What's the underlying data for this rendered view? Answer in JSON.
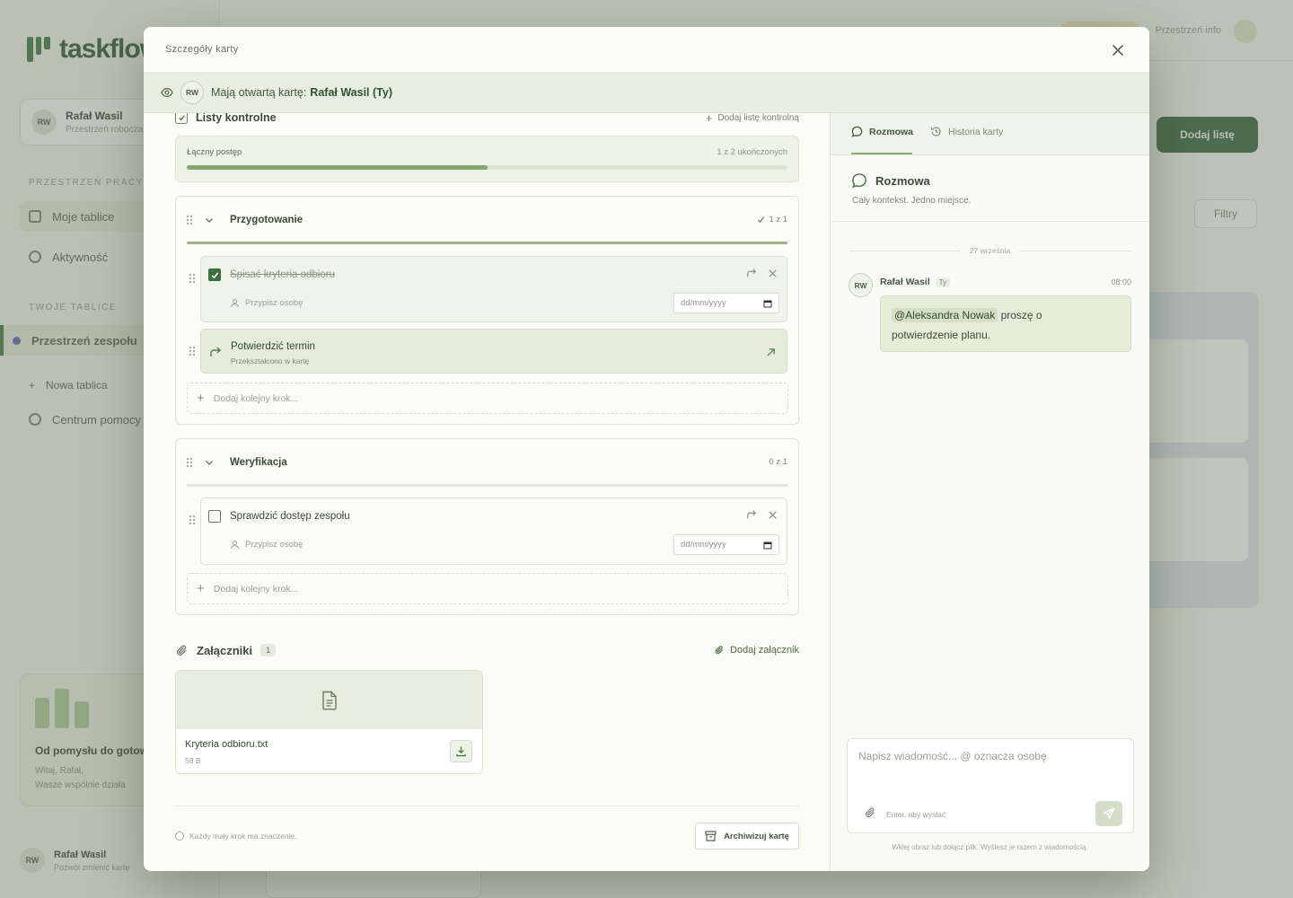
{
  "background": {
    "logo": "taskflow",
    "user_name": "Rafał Wasil",
    "user_initials": "RW",
    "user_sub": "Przestrzeń robocza",
    "section_projects": "PRZESTRZEŃ PRACY",
    "nav": [
      "Moje tablice",
      "Aktywność"
    ],
    "section_boards": "TWOJE TABLICE",
    "project": "Przestrzeń zespołu",
    "new_board": "Nowa tablica",
    "help": "Centrum pomocy",
    "promo_title": "Od pomysłu do gotowego",
    "promo_line1": "Witaj, Rafał,",
    "promo_line2": "Wasze wspólnie działa",
    "add_list": "Dodaj listę",
    "filter": "Filtry",
    "top_text": "Przestrzeń info",
    "bottom_user": "Rafał Wasil",
    "bottom_user_sub": "Pozwól zmienić kartę"
  },
  "modal": {
    "title": "Szczegóły karty",
    "viewers_label": "Mają otwartą kartę:",
    "viewer_name": "Rafał Wasil (Ty)",
    "viewer_initials": "RW"
  },
  "checklists": {
    "title": "Listy kontrolne",
    "add_label": "Dodaj listę kontrolną",
    "overall_label": "Łączny postęp",
    "overall_status": "1 z 2 ukończonych",
    "overall_fraction": 0.5,
    "groups": [
      {
        "name": "Przygotowanie",
        "count": "1 z 1",
        "fraction": 1.0,
        "items": [
          {
            "text": "Spisać kryteria odbioru",
            "done": true,
            "assign": "Przypisz osobę",
            "date_placeholder": "dd/mm/yyyy"
          },
          {
            "text": "Potwierdzić termin",
            "converted": true,
            "sub": "Przekształcono w kartę"
          }
        ],
        "add_step": "Dodaj kolejny krok..."
      },
      {
        "name": "Weryfikacja",
        "count": "0 z 1",
        "fraction": 0.0,
        "items": [
          {
            "text": "Sprawdzić dostęp zespołu",
            "done": false,
            "assign": "Przypisz osobę",
            "date_placeholder": "dd/mm/yyyy"
          }
        ],
        "add_step": "Dodaj kolejny krok..."
      }
    ]
  },
  "attachments": {
    "title": "Załączniki",
    "count": "1",
    "add_label": "Dodaj załącznik",
    "files": [
      {
        "name": "Kryteria odbioru.txt",
        "size": "58 B"
      }
    ]
  },
  "footer": {
    "tip": "Każdy mały krok ma znaczenie.",
    "archive": "Archiwizuj kartę"
  },
  "panel": {
    "tabs": [
      "Rozmowa",
      "Historia karty"
    ],
    "chat_title": "Rozmowa",
    "chat_subtitle": "Cały kontekst. Jedno miejsce.",
    "date_separator": "27 września",
    "message": {
      "author": "Rafał Wasil",
      "initials": "RW",
      "you_badge": "Ty",
      "time": "08:00",
      "mention": "@Aleksandra Nowak",
      "text_part1": "proszę o",
      "text_part2": "potwierdzenie planu."
    },
    "composer_placeholder": "Napisz wiadomość... @ oznacza osobę",
    "composer_hint": "Enter, aby wysłać",
    "footnote": "Wklej obraz lub dołącz plik. Wyślesz je razem z wiadomością."
  },
  "colors": {
    "accent": "#3e6e3e",
    "progress_fill": "#82a86f",
    "panel_bg": "#eff3e9"
  }
}
